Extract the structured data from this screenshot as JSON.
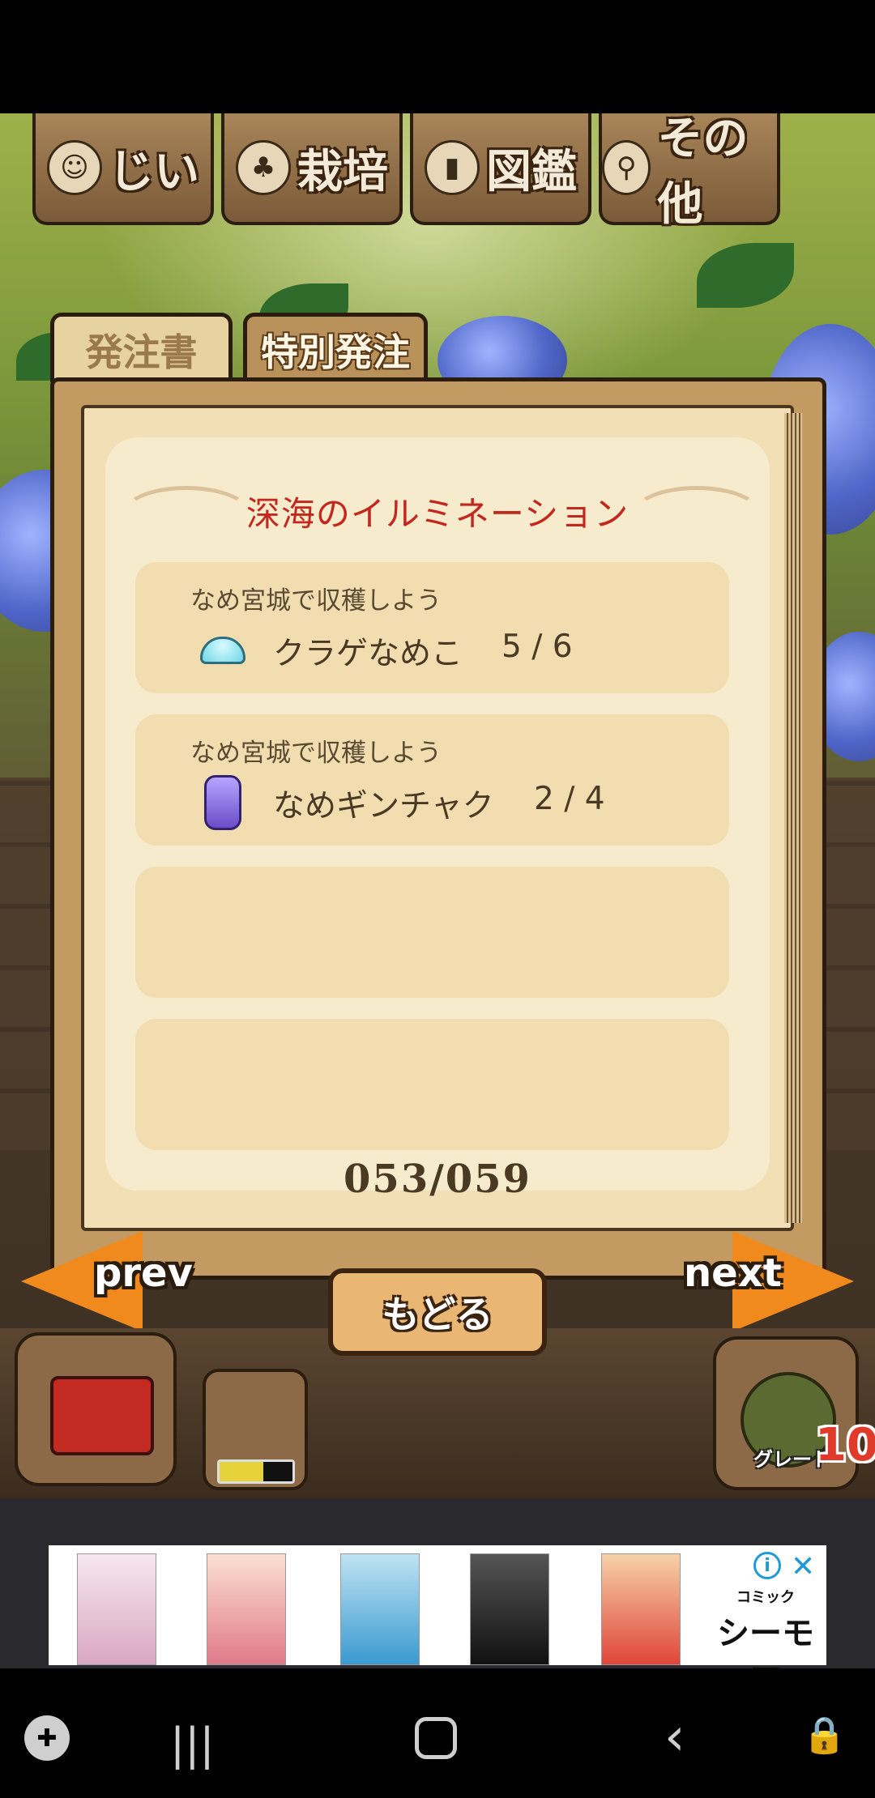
{
  "top_menu": [
    {
      "label": "じい",
      "icon": "old-man-icon"
    },
    {
      "label": "栽培",
      "icon": "mushroom-log-icon"
    },
    {
      "label": "図鑑",
      "icon": "book-icon"
    },
    {
      "label": "その他",
      "icon": "magnifier-icon"
    }
  ],
  "tabs": {
    "order_sheet": "発注書",
    "special_order": "特別発注"
  },
  "panel": {
    "title": "深海のイルミネーション",
    "tasks": [
      {
        "subtitle": "なめ宮城で収穫しよう",
        "name": "クラゲなめこ",
        "progress": "5 / 6",
        "icon": "jellyfish-nameko-icon"
      },
      {
        "subtitle": "なめ宮城で収穫しよう",
        "name": "なめギンチャク",
        "progress": "2 / 4",
        "icon": "anemone-nameko-icon"
      }
    ],
    "page_counter": "053/059"
  },
  "nav": {
    "prev": "prev",
    "next": "next",
    "back": "もどる"
  },
  "bottom": {
    "grade_label": "グレード",
    "grade_value": "10",
    "sprayer_battery_level": 0.6
  },
  "ad": {
    "brand_small": "コミック",
    "brand_main": "シーモア"
  },
  "colors": {
    "title_red": "#c2281e",
    "panel_brown": "#c39a62",
    "page_cream": "#f2dfb5"
  }
}
